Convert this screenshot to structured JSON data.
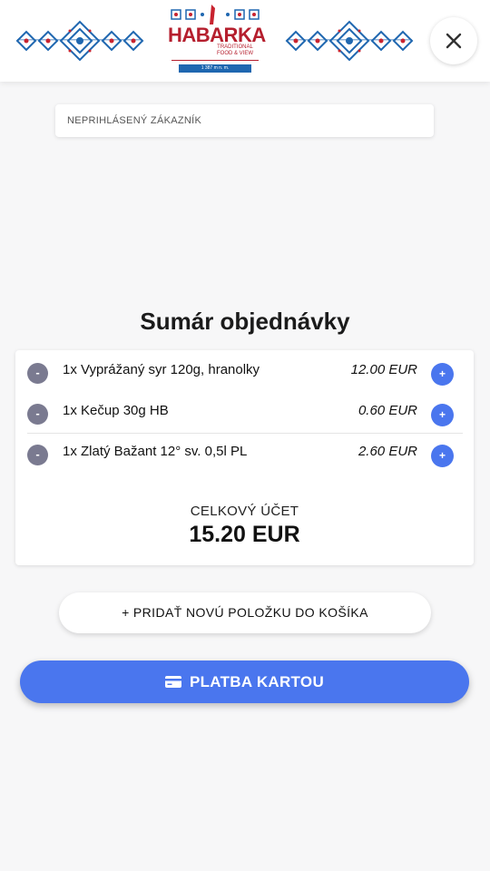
{
  "header": {
    "logo": {
      "name": "HABARKA",
      "tagline_1": "TRADITIONAL",
      "tagline_2": "FOOD & VIEW",
      "altitude": "1 387 m n. m."
    },
    "close_icon": "close-icon"
  },
  "customer": {
    "label": "NEPRIHLÁSENÝ ZÁKAZNÍK"
  },
  "summary": {
    "title": "Sumár objednávky",
    "items": [
      {
        "name": "1x Vyprážaný syr 120g, hranolky",
        "price": "12.00 EUR",
        "minus_label": "-",
        "plus_label": "+"
      },
      {
        "name": "1x Kečup 30g HB",
        "price": "0.60 EUR",
        "minus_label": "-",
        "plus_label": "+"
      },
      {
        "name": "1x Zlatý Bažant 12° sv. 0,5l PL",
        "price": "2.60 EUR",
        "minus_label": "-",
        "plus_label": "+"
      }
    ],
    "total_label": "CELKOVÝ ÚČET",
    "total_value": "15.20 EUR"
  },
  "actions": {
    "add_item_label": "+ PRIDAŤ NOVÚ POLOŽKU DO KOŠÍKA",
    "pay_label": "PLATBA KARTOU",
    "pay_icon": "credit-card-icon"
  },
  "colors": {
    "accent": "#4a76ee",
    "brand_red": "#b51f2e",
    "minus_grey": "#7a7a90",
    "ornament_blue": "#1f67b0"
  }
}
